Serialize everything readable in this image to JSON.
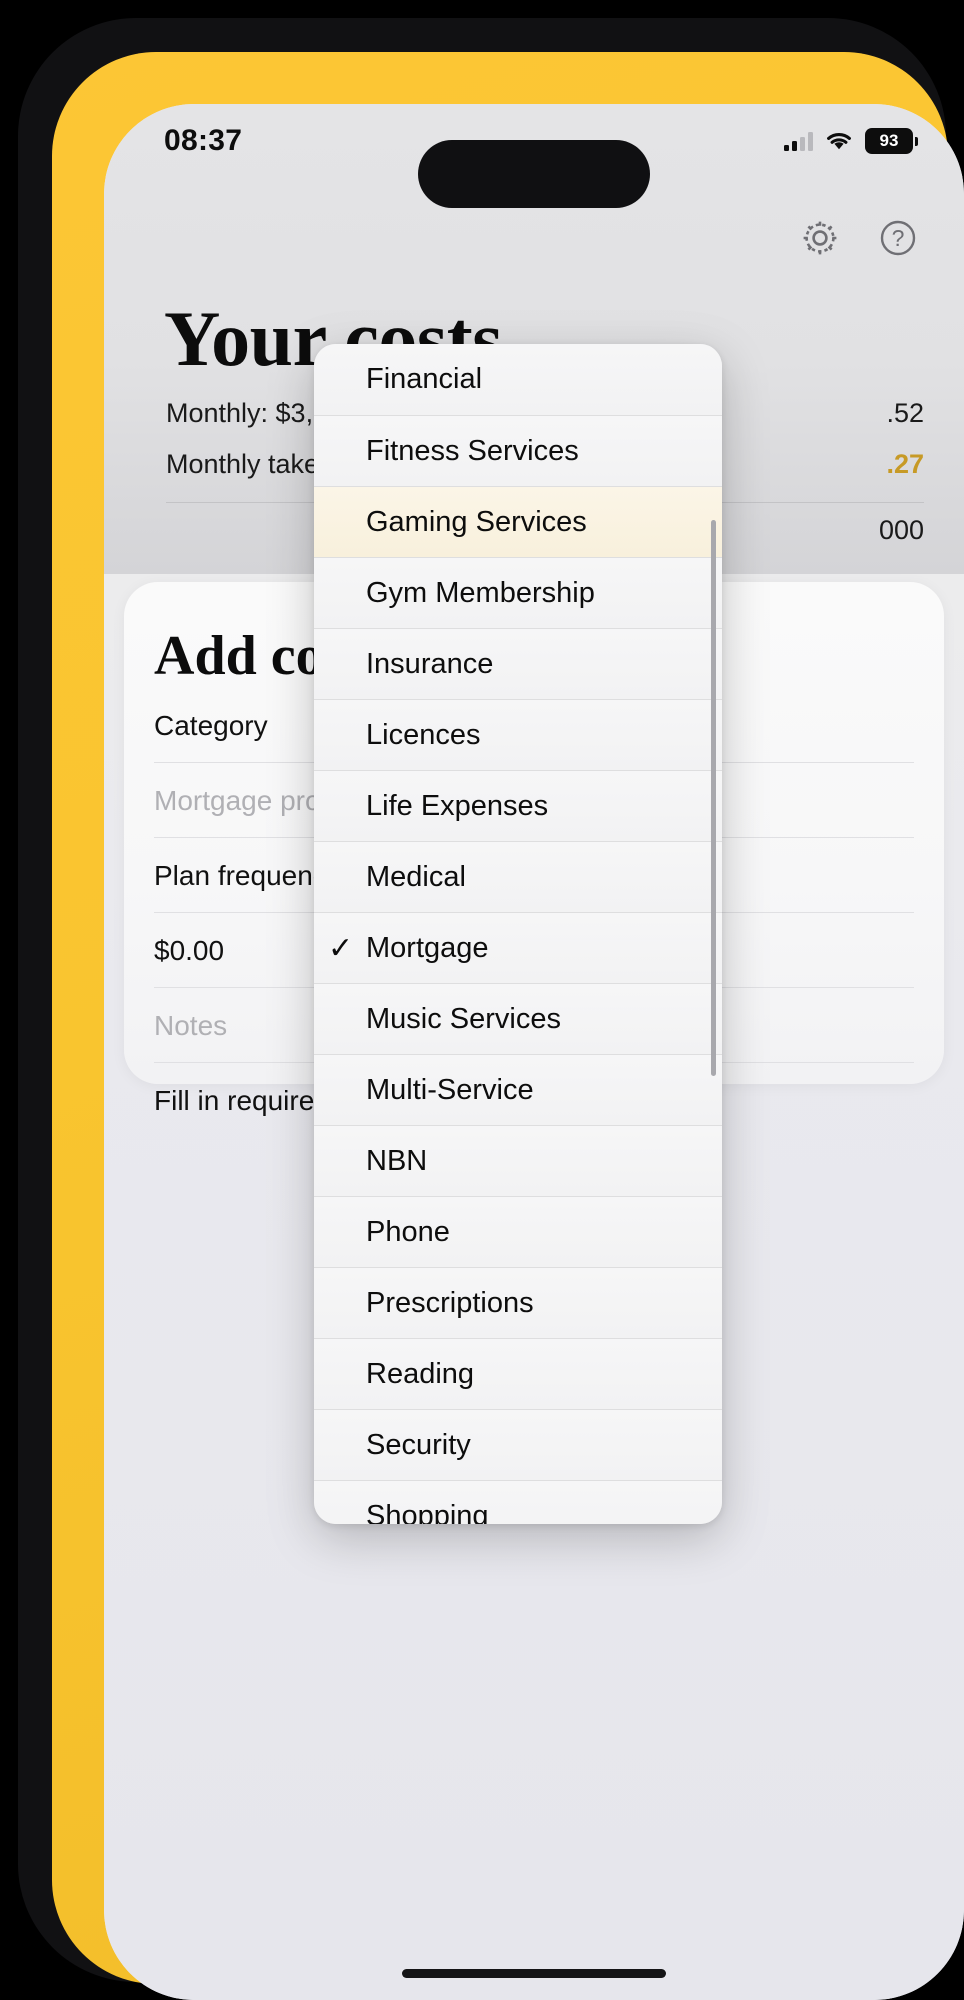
{
  "status": {
    "time": "08:37",
    "battery_level": "93",
    "signal_icon": "cellular-signal-icon",
    "wifi_icon": "wifi-icon",
    "battery_icon": "battery-icon"
  },
  "nav": {
    "settings_icon": "gear-icon",
    "help_icon": "question-mark-circle-icon"
  },
  "header": {
    "title": "Your costs",
    "rows": [
      {
        "label": "Monthly: $3,915.",
        "value": ".52"
      },
      {
        "label": "Monthly take hom",
        "value": ".27"
      },
      {
        "label": "",
        "value": "000"
      }
    ]
  },
  "card": {
    "title": "Add co",
    "fields": [
      {
        "text": "Category",
        "placeholder": false
      },
      {
        "text": "Mortgage pro",
        "placeholder": true
      },
      {
        "text": "Plan frequenc",
        "placeholder": false
      },
      {
        "text": "$0.00",
        "placeholder": false
      },
      {
        "text": "Notes",
        "placeholder": true
      },
      {
        "text": "Fill in required",
        "placeholder": false
      }
    ]
  },
  "dropdown": {
    "selected": "Mortgage",
    "highlighted": "Gaming Services",
    "checkmark_glyph": "✓",
    "items": [
      {
        "label": "Financial",
        "checked": false,
        "highlighted": false
      },
      {
        "label": "Fitness Services",
        "checked": false,
        "highlighted": false
      },
      {
        "label": "Gaming Services",
        "checked": false,
        "highlighted": true
      },
      {
        "label": "Gym Membership",
        "checked": false,
        "highlighted": false
      },
      {
        "label": "Insurance",
        "checked": false,
        "highlighted": false
      },
      {
        "label": "Licences",
        "checked": false,
        "highlighted": false
      },
      {
        "label": "Life Expenses",
        "checked": false,
        "highlighted": false
      },
      {
        "label": "Medical",
        "checked": false,
        "highlighted": false
      },
      {
        "label": "Mortgage",
        "checked": true,
        "highlighted": false
      },
      {
        "label": "Music Services",
        "checked": false,
        "highlighted": false
      },
      {
        "label": "Multi-Service",
        "checked": false,
        "highlighted": false
      },
      {
        "label": "NBN",
        "checked": false,
        "highlighted": false
      },
      {
        "label": "Phone",
        "checked": false,
        "highlighted": false
      },
      {
        "label": "Prescriptions",
        "checked": false,
        "highlighted": false
      },
      {
        "label": "Reading",
        "checked": false,
        "highlighted": false
      },
      {
        "label": "Security",
        "checked": false,
        "highlighted": false
      },
      {
        "label": "Shopping",
        "checked": false,
        "highlighted": false
      }
    ]
  },
  "colors": {
    "accent_yellow": "#f9c52f",
    "gold_text": "#c79a26",
    "highlight_row": "#faf2e2"
  }
}
